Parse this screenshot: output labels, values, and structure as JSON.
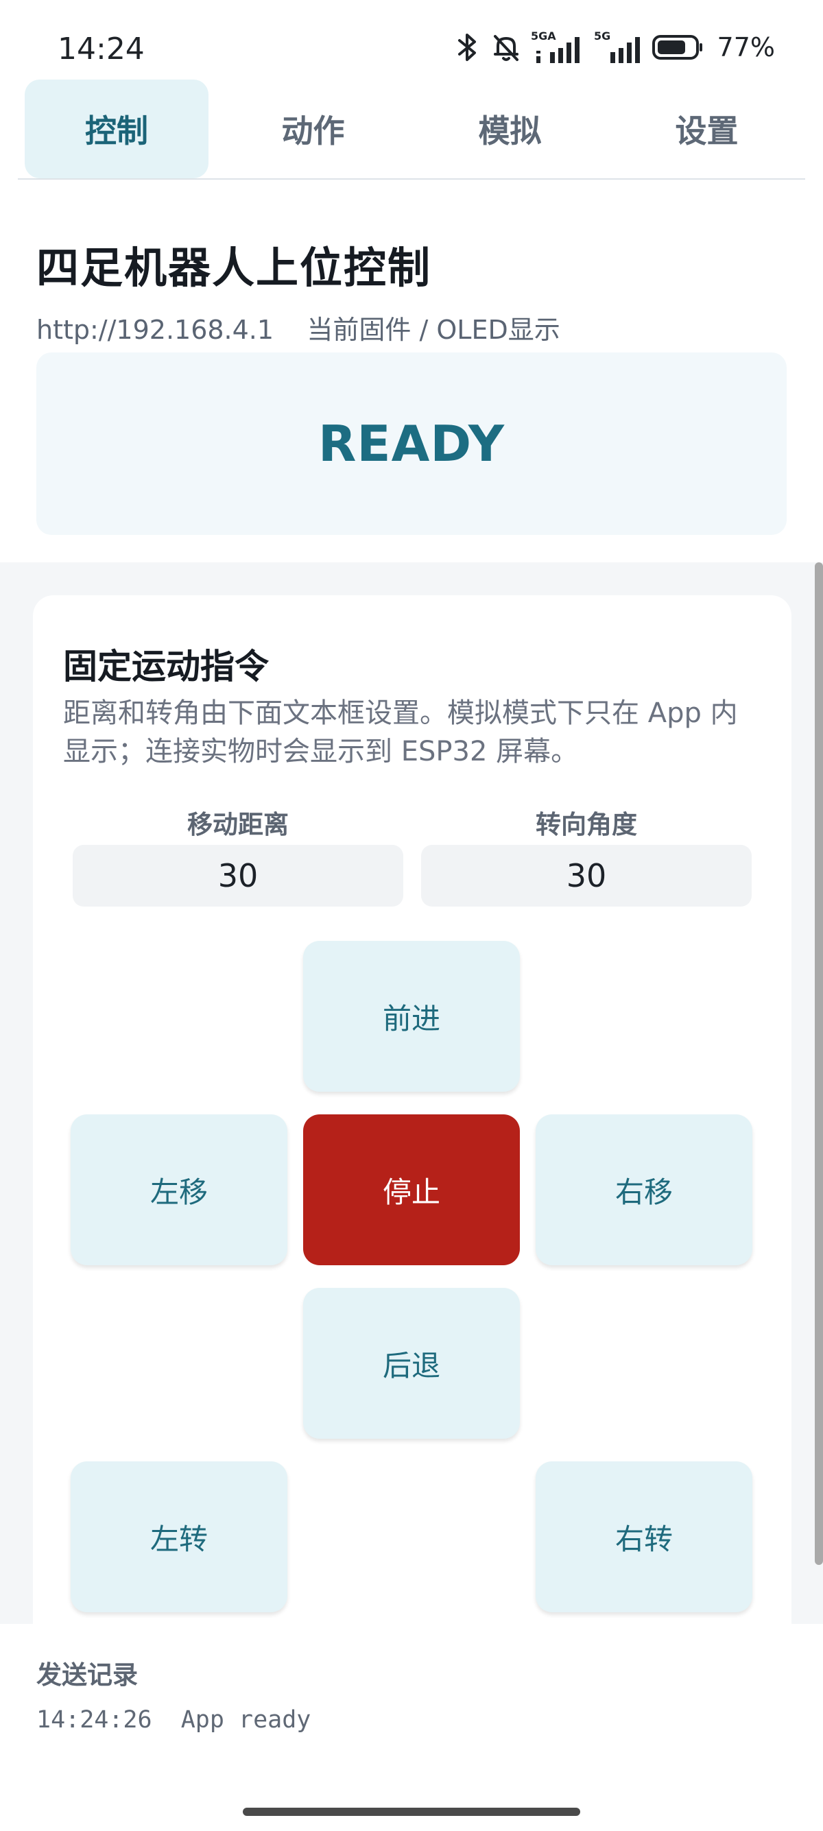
{
  "status_bar": {
    "time": "14:24",
    "net1": "5GA",
    "net2": "5G",
    "battery_pct": "77%",
    "battery_level": 0.77,
    "icons": [
      "bluetooth-icon",
      "bell-off-icon",
      "signal-5ga-icon",
      "signal-5g-icon",
      "battery-icon"
    ]
  },
  "tabs": [
    {
      "label": "控制",
      "active": true
    },
    {
      "label": "动作",
      "active": false
    },
    {
      "label": "模拟",
      "active": false
    },
    {
      "label": "设置",
      "active": false
    }
  ],
  "header": {
    "title": "四足机器人上位控制",
    "url": "http://192.168.4.1",
    "firmware": "当前固件 / OLED显示",
    "display_text": "READY"
  },
  "card": {
    "title": "固定运动指令",
    "description": "距离和转角由下面文本框设置。模拟模式下只在 App 内显示；连接实物时会显示到 ESP32 屏幕。",
    "distance_label": "移动距离",
    "distance_value": "30",
    "angle_label": "转向角度",
    "angle_value": "30",
    "buttons": {
      "forward": "前进",
      "left_move": "左移",
      "stop": "停止",
      "right_move": "右移",
      "backward": "后退",
      "left_turn": "左转",
      "right_turn": "右转"
    }
  },
  "log": {
    "title": "发送记录",
    "entries": [
      {
        "time": "14:24:26",
        "message": "App ready"
      }
    ]
  },
  "colors": {
    "accent": "#1b6478",
    "button_bg": "#e4f3f7",
    "stop_bg": "#b52119"
  }
}
